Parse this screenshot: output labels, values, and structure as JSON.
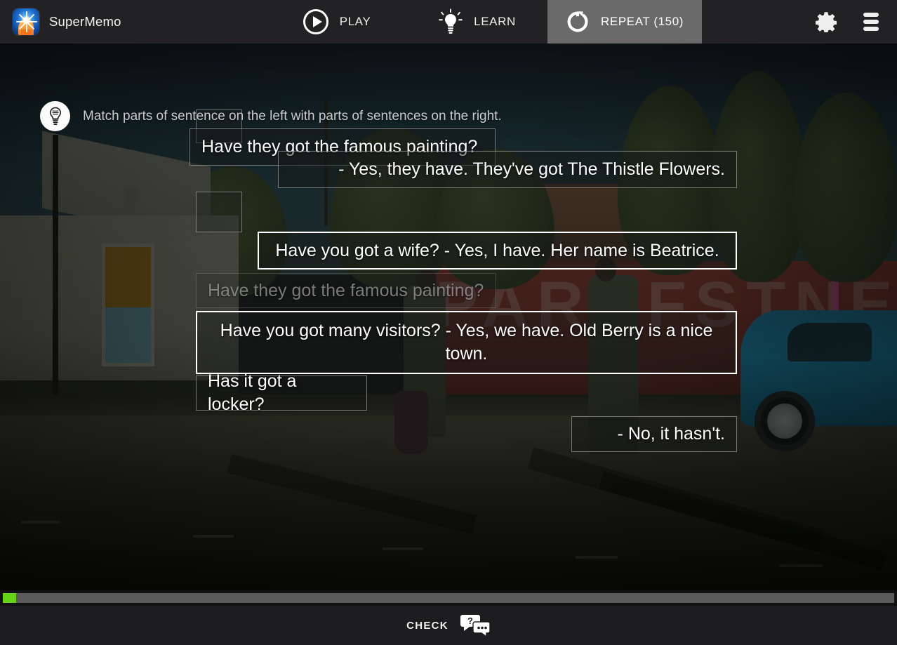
{
  "app": {
    "brand_name": "SuperMemo",
    "logo_icon": "supermemo-head-logo"
  },
  "topbar": {
    "tabs": [
      {
        "id": "play",
        "label": "PLAY",
        "icon": "play-circle-icon",
        "active": false
      },
      {
        "id": "learn",
        "label": "LEARN",
        "icon": "lightbulb-icon",
        "active": false
      },
      {
        "id": "repeat",
        "label": "REPEAT (150)",
        "icon": "repeat-arrow-icon",
        "active": true
      }
    ],
    "settings_icon": "gear-icon",
    "menu_icon": "hamburger-menu-icon"
  },
  "instruction": {
    "icon": "lightbulb-hint-icon",
    "text": "Match parts of sentence on the left with parts of sentences on the right."
  },
  "exercise": {
    "slots": [
      {
        "id": "slot-1",
        "label": ""
      },
      {
        "id": "slot-2",
        "label": ""
      }
    ],
    "cards": [
      {
        "id": "card-1",
        "text": "Have they got the famous painting?",
        "align": "left",
        "state": "normal"
      },
      {
        "id": "card-2",
        "text": "- Yes, they have. They've got The Thistle Flowers.",
        "align": "right",
        "state": "normal"
      },
      {
        "id": "card-3",
        "text": "Have you got a wife? - Yes, I have. Her name is Beatrice.",
        "align": "center",
        "state": "selected"
      },
      {
        "id": "card-4",
        "text": "Have they got the famous painting?",
        "align": "left",
        "state": "used"
      },
      {
        "id": "card-5",
        "text": "Have you got many visitors? - Yes, we have. Old Berry is a nice town.",
        "align": "center",
        "state": "selected"
      },
      {
        "id": "card-6",
        "text": "Has it got a locker?",
        "align": "left",
        "state": "normal"
      },
      {
        "id": "card-7",
        "text": "- No, it hasn't.",
        "align": "right",
        "state": "normal"
      }
    ]
  },
  "progress": {
    "percent": 1.5,
    "fill_color": "#66d416",
    "track_color": "#5b5b5b"
  },
  "footer": {
    "check_label": "CHECK",
    "check_icon": "speech-bubbles-question-icon"
  },
  "background": {
    "wall_text": "PARKFSTNE"
  }
}
